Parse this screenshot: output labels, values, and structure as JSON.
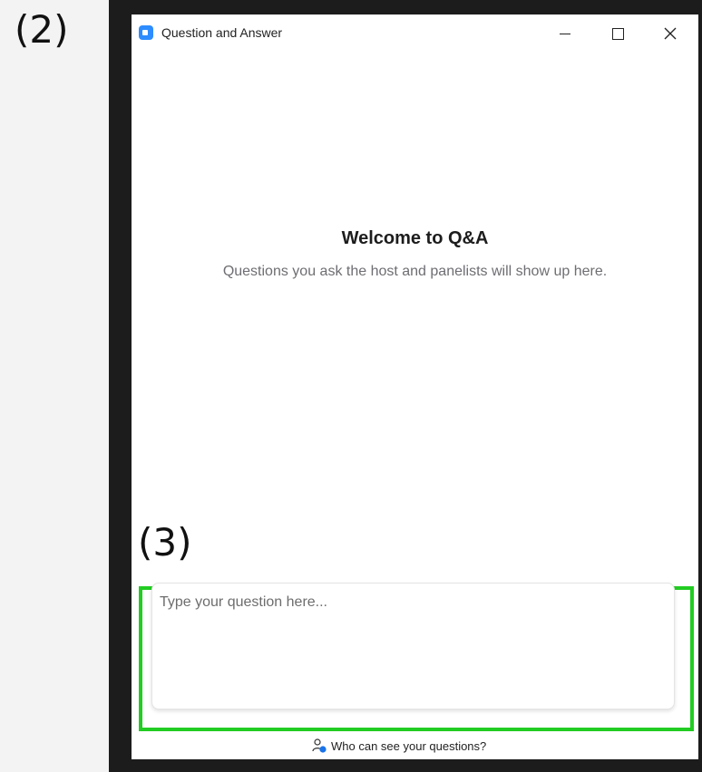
{
  "annotations": {
    "step2": "(2)",
    "step3": "(3)"
  },
  "window": {
    "title": "Question and Answer",
    "controls": {
      "minimize_icon": "minimize-icon",
      "maximize_icon": "maximize-icon",
      "close_icon": "close-icon"
    }
  },
  "welcome": {
    "title": "Welcome to Q&A",
    "body": "Questions you ask the host and panelists will show up here."
  },
  "question_input": {
    "placeholder": "Type your question here...",
    "value": ""
  },
  "footer": {
    "link_label": "Who can see your questions?",
    "icon": "person-info-icon"
  },
  "colors": {
    "highlight": "#22cc22",
    "app_icon": "#2d8cff",
    "frame": "#1c1c1c"
  }
}
